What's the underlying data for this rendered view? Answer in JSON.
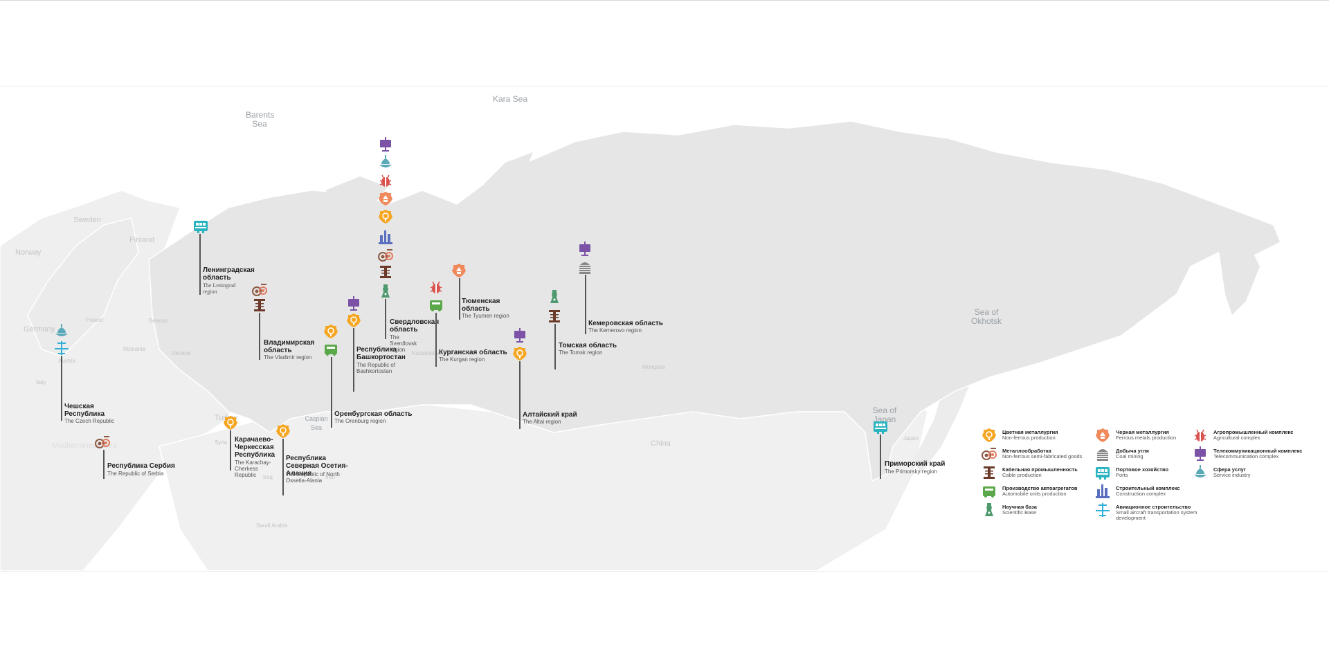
{
  "map": {
    "seas": [
      {
        "id": "kara",
        "label": "Kara Sea"
      },
      {
        "id": "barents",
        "label": "Barents Sea"
      },
      {
        "id": "okhotsk",
        "label": "Sea of Okhotsk"
      },
      {
        "id": "japan",
        "label": "Sea of Japan"
      },
      {
        "id": "caspian",
        "label": "Caspian Sea"
      },
      {
        "id": "med",
        "label": "Mediterranean Sea"
      }
    ],
    "countries": [
      "Sweden",
      "Norway",
      "Finland",
      "Poland",
      "Belarus",
      "Ukraine",
      "Germany",
      "Romania",
      "Italy",
      "Austria",
      "Turkey",
      "Kazakhstan",
      "Mongolia",
      "China",
      "Japan",
      "Iran",
      "Iraq",
      "Syria",
      "Saudi Arabia"
    ]
  },
  "regions": [
    {
      "id": "czech",
      "ru": "Чешская Республика",
      "en": "The Czech Republic"
    },
    {
      "id": "serbia",
      "ru": "Республика Сербия",
      "en": "The Republic of Serbia"
    },
    {
      "id": "leningrad",
      "ru": "Ленинградская область",
      "en": "The Leningrad region"
    },
    {
      "id": "vladimir",
      "ru": "Владимирская область",
      "en": "The Vladimir region"
    },
    {
      "id": "karachay",
      "ru": "Карачаево-Черкесская Республика",
      "en": "The Karachay-Cherkess Republic"
    },
    {
      "id": "ossetia",
      "ru": "Республика Северная Осетия-Алания",
      "en": "The Republic of North Ossetia-Alania"
    },
    {
      "id": "orenburg",
      "ru": "Оренбургская область",
      "en": "The Orenburg region"
    },
    {
      "id": "bashkortostan",
      "ru": "Республика Башкортостан",
      "en": "The Republic of Bashkortostan"
    },
    {
      "id": "sverdlovsk",
      "ru": "Свердловская область",
      "en": "The Sverdlovsk region"
    },
    {
      "id": "kurgan",
      "ru": "Курганская область",
      "en": "The Kurgan region"
    },
    {
      "id": "tyumen",
      "ru": "Тюменская область",
      "en": "The Tyumen region"
    },
    {
      "id": "altai",
      "ru": "Алтайский край",
      "en": "The Altai region"
    },
    {
      "id": "tomsk",
      "ru": "Томская область",
      "en": "The Tomsk region"
    },
    {
      "id": "kemerovo",
      "ru": "Кемеровская область",
      "en": "The Kemerovo region"
    },
    {
      "id": "primorsky",
      "ru": "Приморский край",
      "en": "The Primorsky region"
    }
  ],
  "legend": [
    {
      "icon": "nonferrous",
      "ru": "Цветная металлургия",
      "en": "Non-ferrous production",
      "color": "#f5a623"
    },
    {
      "icon": "metalworking",
      "ru": "Металлообработка",
      "en": "Non-ferrous semi-fabricated goods",
      "color": "#8b5a44"
    },
    {
      "icon": "cable",
      "ru": "Кабельная промышленность",
      "en": "Cable production",
      "color": "#6b3a2a"
    },
    {
      "icon": "automobile",
      "ru": "Производство автоагрегатов",
      "en": "Automobile units production",
      "color": "#5aa84a"
    },
    {
      "icon": "science",
      "ru": "Научная база",
      "en": "Scientific Base",
      "color": "#4e9a6e"
    },
    {
      "icon": "ferrous",
      "ru": "Черная металлургия",
      "en": "Ferrous metals production",
      "color": "#f08a5d"
    },
    {
      "icon": "coal",
      "ru": "Добыча угля",
      "en": "Coal mining",
      "color": "#888888"
    },
    {
      "icon": "ports",
      "ru": "Портовое хозяйство",
      "en": "Ports",
      "color": "#2ab3c0"
    },
    {
      "icon": "construction",
      "ru": "Строительный комплекс",
      "en": "Construction complex",
      "color": "#5b6fbf"
    },
    {
      "icon": "aviation",
      "ru": "Авиационное строительство",
      "en": "Small aircraft transportation system development",
      "color": "#30b0d8"
    },
    {
      "icon": "agro",
      "ru": "Агропромышленный комплекс",
      "en": "Agricultural complex",
      "color": "#d9534f"
    },
    {
      "icon": "telecom",
      "ru": "Телекоммуникационный комплекс",
      "en": "Telecommunication complex",
      "color": "#7b52a6"
    },
    {
      "icon": "service",
      "ru": "Сфера услуг",
      "en": "Service industry",
      "color": "#5aa9b8"
    }
  ]
}
